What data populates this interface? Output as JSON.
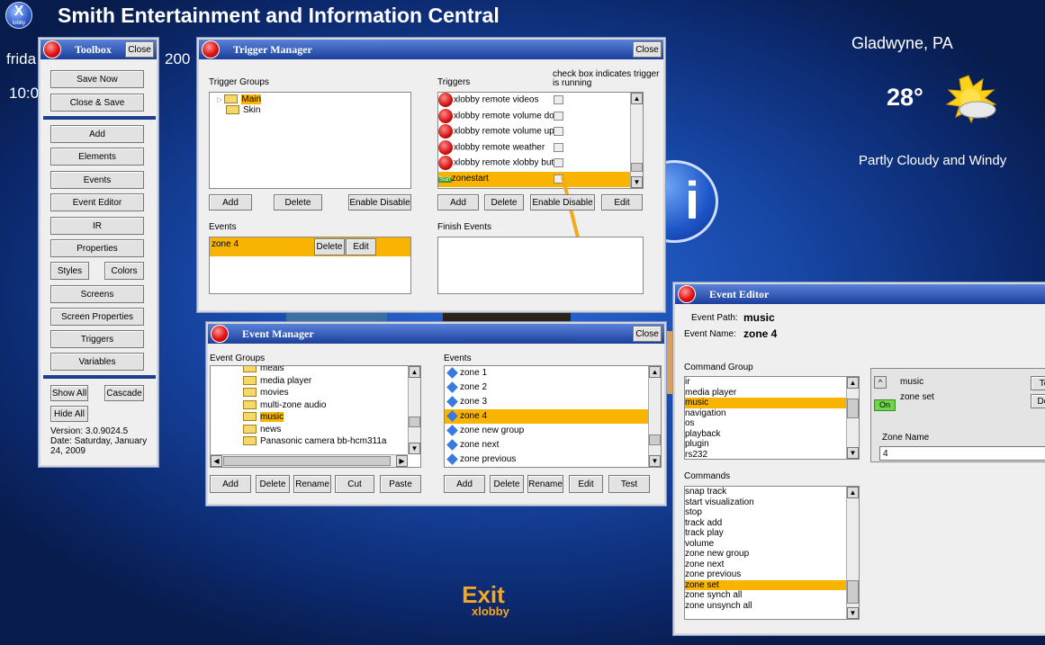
{
  "desktop": {
    "logo": "X",
    "logo_sub": "lobby",
    "title": "Smith Entertainment and Information Central",
    "date": "frida",
    "year": "200",
    "time": "10:0",
    "location": "Gladwyne, PA",
    "temperature": "28°",
    "condition": "Partly Cloudy and Windy",
    "weather_icon": "partly-cloudy-icon",
    "exit_label": "Exit",
    "exit_sub": "xlobby",
    "info_glyph": "i"
  },
  "toolbox": {
    "title": "Toolbox",
    "close": "Close",
    "buttons": [
      "Save Now",
      "Close & Save",
      "Add",
      "Elements",
      "Events",
      "Event Editor",
      "IR",
      "Properties",
      "Styles",
      "Colors",
      "Screens",
      "Screen Properties",
      "Triggers",
      "Variables",
      "Show All",
      "Cascade",
      "Hide All"
    ],
    "version": "Version: 3.0.9024.5",
    "date": "Date: Saturday, January 24, 2009"
  },
  "trigger_manager": {
    "title": "Trigger Manager",
    "close": "Close",
    "groups_label": "Trigger Groups",
    "groups": [
      "Main",
      "Skin"
    ],
    "triggers_label": "Triggers",
    "running_note": "check box indicates trigger is running",
    "triggers": [
      "xlobby remote videos",
      "xlobby remote volume do",
      "xlobby remote volume up",
      "xlobby remote weather",
      "xlobby remote xlobby butt",
      "zonestart"
    ],
    "start_badge": "Start",
    "group_buttons": [
      "Add",
      "Delete",
      "Enable Disable"
    ],
    "trigger_buttons": [
      "Add",
      "Delete",
      "Enable Disable",
      "Edit"
    ],
    "events_label": "Events",
    "event_item": "zone 4",
    "event_delete": "Delete",
    "event_edit": "Edit",
    "finish_label": "Finish Events"
  },
  "event_manager": {
    "title": "Event Manager",
    "close": "Close",
    "groups_label": "Event Groups",
    "events_label": "Events",
    "groups": [
      "meals",
      "media player",
      "movies",
      "multi-zone audio",
      "music",
      "news",
      "Panasonic camera bb-hcm311a"
    ],
    "selected_group": "music",
    "events": [
      "zone 1",
      "zone 2",
      "zone 3",
      "zone 4",
      "zone new group",
      "zone next",
      "zone previous"
    ],
    "selected_event": "zone 4",
    "left_buttons": [
      "Add",
      "Delete",
      "Rename",
      "Cut",
      "Paste"
    ],
    "right_buttons": [
      "Add",
      "Delete",
      "Rename",
      "Edit",
      "Test"
    ]
  },
  "event_editor": {
    "title": "Event Editor",
    "path_label": "Event Path:",
    "path": "music",
    "name_label": "Event Name:",
    "name": "zone 4",
    "cmd_group_label": "Command Group",
    "cmd_groups": [
      "ir",
      "media player",
      "music",
      "navigation",
      "os",
      "playback",
      "plugin",
      "rs232"
    ],
    "selected_group": "music",
    "commands_label": "Commands",
    "commands": [
      "snap track",
      "start visualization",
      "stop",
      "track add",
      "track play",
      "volume",
      "zone new group",
      "zone next",
      "zone previous",
      "zone set",
      "zone synch all",
      "zone unsynch all"
    ],
    "selected_command": "zone set",
    "step_group": "music",
    "step_cmd": "zone set",
    "on_badge": "On",
    "zone_name_label": "Zone Name",
    "zone_name_value": "4",
    "test_btn": "Te",
    "delete_btn": "Del"
  }
}
